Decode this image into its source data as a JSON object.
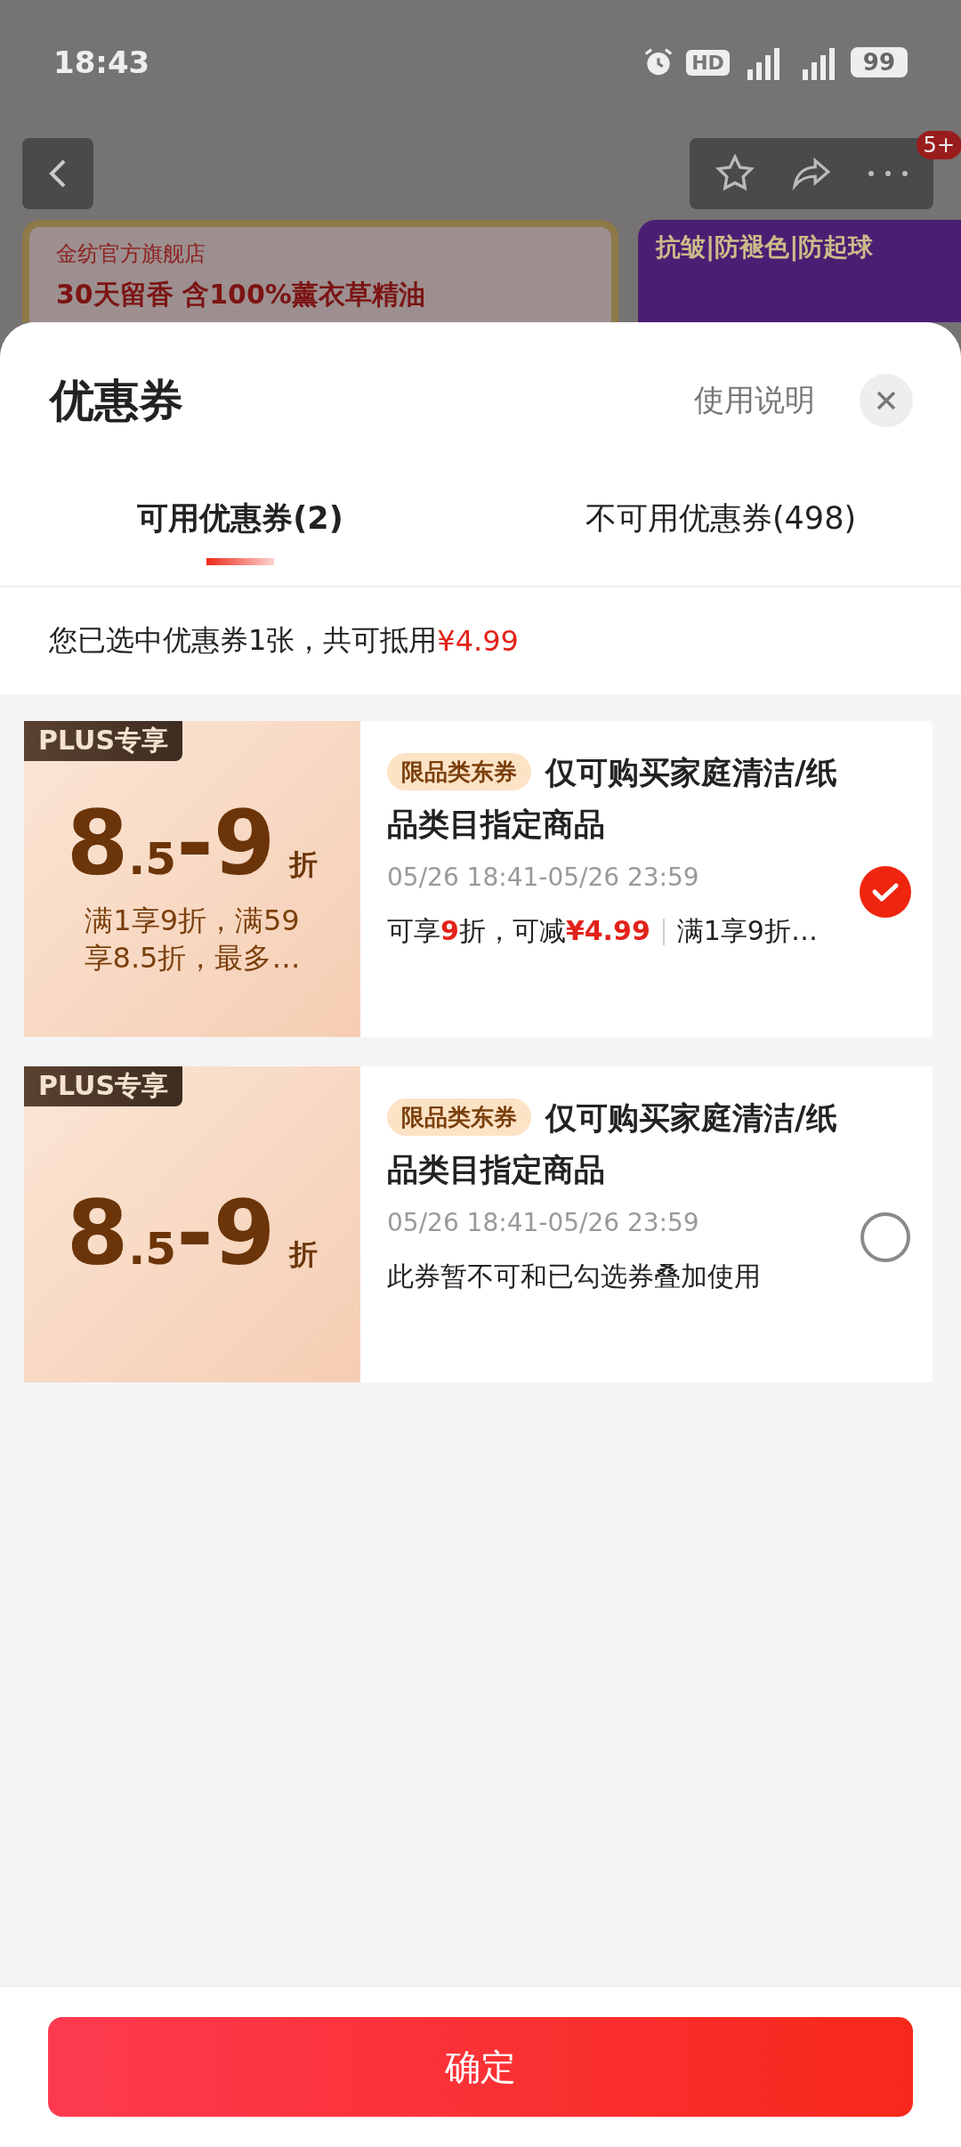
{
  "status_bar": {
    "time": "18:43",
    "hd": "HD",
    "battery": "99"
  },
  "page_behind": {
    "cart_badge": "5+",
    "store_name": "金纺官方旗舰店",
    "headline": "30天留香 含100%薰衣草精油",
    "side_banner": "抗皱|防褪色|防起球"
  },
  "sheet": {
    "title": "优惠券",
    "help_link": "使用说明",
    "tabs": [
      {
        "label": "可用优惠券(2)",
        "selected": true
      },
      {
        "label": "不可用优惠券(498)",
        "selected": false
      }
    ],
    "summary": {
      "text": "您已选中优惠券1张，共可抵用",
      "amount": "¥4.99"
    },
    "coupons": [
      {
        "badge": "PLUS专享",
        "amount_integer": "8",
        "amount_fraction": ".5",
        "amount_max": "-9",
        "unit": "折",
        "condition": "满1享9折，满59享8.5折，最多…",
        "tag": "限品类东券",
        "title": "仅可购买家庭清洁/纸品类目指定商品",
        "validity": "05/26 18:41-05/26 23:59",
        "note": "可享**9**折，可减**¥4.99**",
        "note_extra": "满1享9折…",
        "selected": true
      },
      {
        "badge": "PLUS专享",
        "amount_integer": "8",
        "amount_fraction": ".5",
        "amount_max": "-9",
        "unit": "折",
        "tag": "限品类东券",
        "title": "仅可购买家庭清洁/纸品类目指定商品",
        "validity": "05/26 18:41-05/26 23:59",
        "note": "此券暂不可和已勾选券叠加使用",
        "selected": false
      }
    ],
    "confirm_button": "确定"
  }
}
